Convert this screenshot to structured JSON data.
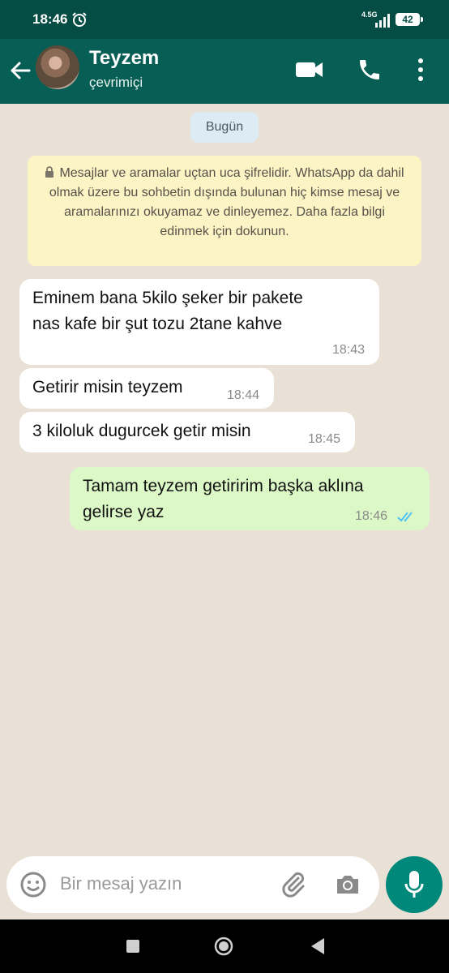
{
  "status_bar": {
    "time": "18:46",
    "network": "4.5G",
    "battery": "42"
  },
  "header": {
    "contact_name": "Teyzem",
    "status": "çevrimiçi"
  },
  "chat": {
    "date_label": "Bugün",
    "encryption_notice": "Mesajlar ve aramalar uçtan uca şifrelidir. WhatsApp da dahil olmak üzere bu sohbetin dışında bulunan hiç kimse mesaj ve aramalarınızı okuyamaz ve dinleyemez. Daha fazla bilgi edinmek için dokunun.",
    "messages": [
      {
        "direction": "in",
        "lines": [
          "Eminem bana 5kilo şeker bir pakete",
          "nas kafe bir şut tozu  2tane kahve"
        ],
        "time": "18:43"
      },
      {
        "direction": "in",
        "lines": [
          "Getirir misin teyzem"
        ],
        "time": "18:44"
      },
      {
        "direction": "in",
        "lines": [
          "3 kiloluk dugurcek getir misin"
        ],
        "time": "18:45"
      },
      {
        "direction": "out",
        "lines": [
          "Tamam teyzem getiririm başka aklına",
          "gelirse yaz"
        ],
        "time": "18:46",
        "read_status": "read"
      }
    ]
  },
  "input": {
    "placeholder": "Bir mesaj yazın"
  },
  "colors": {
    "header": "#075e54",
    "outgoing_bubble": "#dcf8c6",
    "read_ticks": "#4fc3f7",
    "mic_button": "#00897b"
  }
}
